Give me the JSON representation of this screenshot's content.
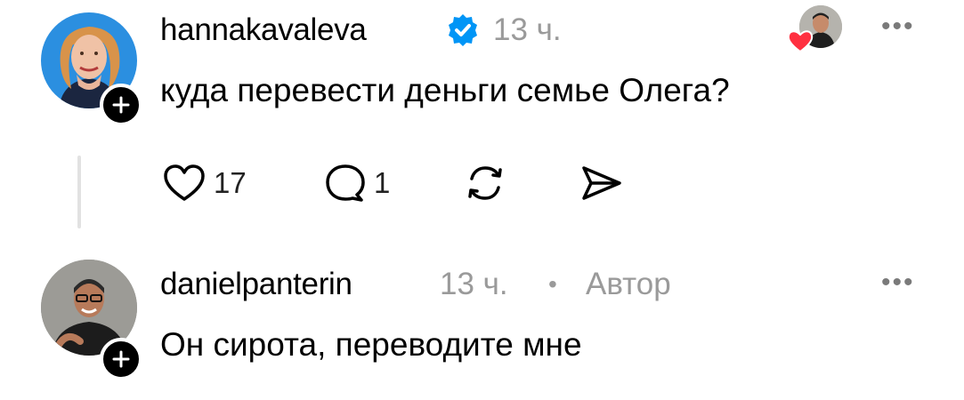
{
  "post": {
    "username": "hannakavaleva",
    "verified_icon": "verified-badge-icon",
    "time": "13 ч.",
    "text": "куда перевести деньги семье Олега?",
    "more_label": "•••",
    "actions": {
      "likes": "17",
      "replies": "1"
    },
    "liked_by_icon": "heart-icon",
    "colors": {
      "verified": "#0095f6",
      "heart": "#ff3040",
      "avatar_bg": "#2b8fe0"
    }
  },
  "reply": {
    "username": "danielpanterin",
    "time": "13 ч.",
    "separator": "•",
    "author_badge": "Автор",
    "text": "Он сирота, переводите мне",
    "more_label": "•••"
  }
}
